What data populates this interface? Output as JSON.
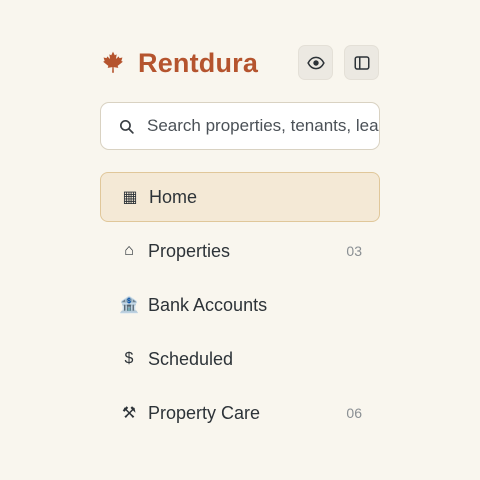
{
  "brand": {
    "name": "Rentdura",
    "icon": "maple-leaf-icon",
    "color": "#b5542e"
  },
  "header_actions": [
    {
      "icon": "eye-icon"
    },
    {
      "icon": "sidebar-toggle-icon"
    }
  ],
  "search": {
    "placeholder": "Search properties, tenants, leases",
    "value": ""
  },
  "nav": {
    "items": [
      {
        "label": "Home",
        "icon": "grid-icon",
        "glyph": "▦",
        "count": "",
        "active": true
      },
      {
        "label": "Properties",
        "icon": "house-icon",
        "glyph": "⌂",
        "count": "03",
        "active": false
      },
      {
        "label": "Bank Accounts",
        "icon": "bank-icon",
        "glyph": "🏦",
        "count": "",
        "active": false
      },
      {
        "label": "Scheduled",
        "icon": "dollar-icon",
        "glyph": "$",
        "count": "",
        "active": false
      },
      {
        "label": "Property Care",
        "icon": "tools-icon",
        "glyph": "⚒",
        "count": "06",
        "active": false
      }
    ]
  },
  "colors": {
    "background": "#f9f6ee",
    "active_bg": "#f4e9d6",
    "active_border": "#e0c79a"
  }
}
